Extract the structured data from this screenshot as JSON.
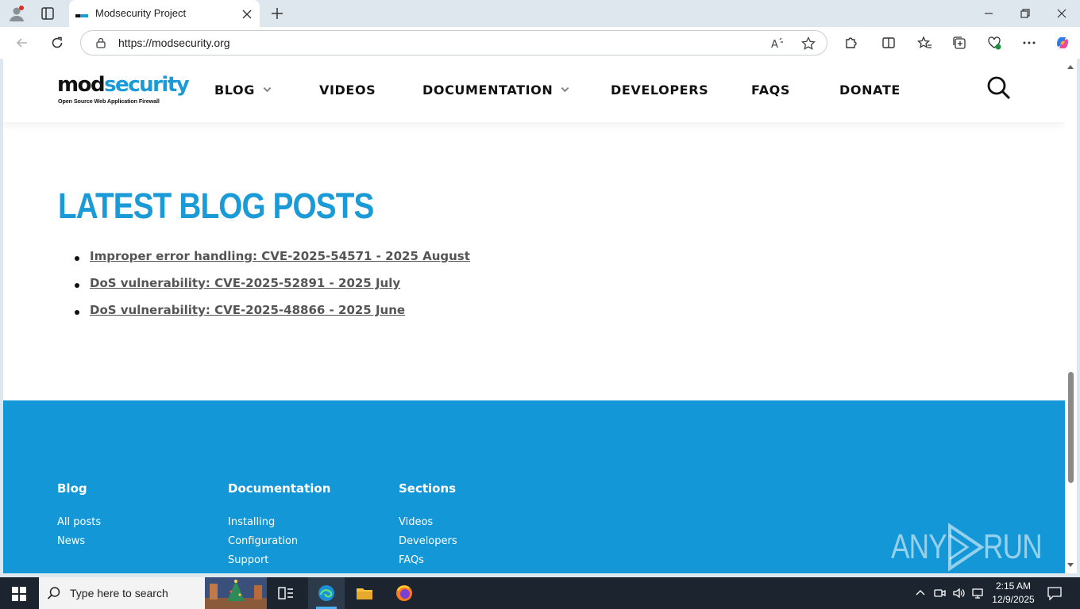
{
  "browser": {
    "tab_title": "Modsecurity Project",
    "url": "https://modsecurity.org"
  },
  "site": {
    "logo": {
      "mod": "mod",
      "security": "security",
      "tagline": "Open Source Web Application Firewall"
    },
    "nav": [
      {
        "label": "BLOG",
        "has_dropdown": true
      },
      {
        "label": "VIDEOS",
        "has_dropdown": false
      },
      {
        "label": "DOCUMENTATION",
        "has_dropdown": true
      },
      {
        "label": "DEVELOPERS",
        "has_dropdown": false
      },
      {
        "label": "FAQS",
        "has_dropdown": false
      },
      {
        "label": "DONATE",
        "has_dropdown": false
      }
    ],
    "blog_heading": "LATEST BLOG POSTS",
    "posts": [
      "Improper error handling: CVE-2025-54571 - 2025 August",
      "DoS vulnerability: CVE-2025-52891 - 2025 July",
      "DoS vulnerability: CVE-2025-48866 - 2025 June"
    ],
    "footer": {
      "columns": [
        {
          "title": "Blog",
          "links": [
            "All posts",
            "News"
          ]
        },
        {
          "title": "Documentation",
          "links": [
            "Installing",
            "Configuration",
            "Support"
          ]
        },
        {
          "title": "Sections",
          "links": [
            "Videos",
            "Developers",
            "FAQs"
          ]
        }
      ],
      "watermark": {
        "left": "ANY",
        "right": "RUN"
      }
    },
    "colors": {
      "brand_blue": "#1a9ad6",
      "footer_blue": "#1497d6"
    }
  },
  "taskbar": {
    "search_placeholder": "Type here to search",
    "time": "2:15 AM",
    "date": "12/9/2025"
  }
}
